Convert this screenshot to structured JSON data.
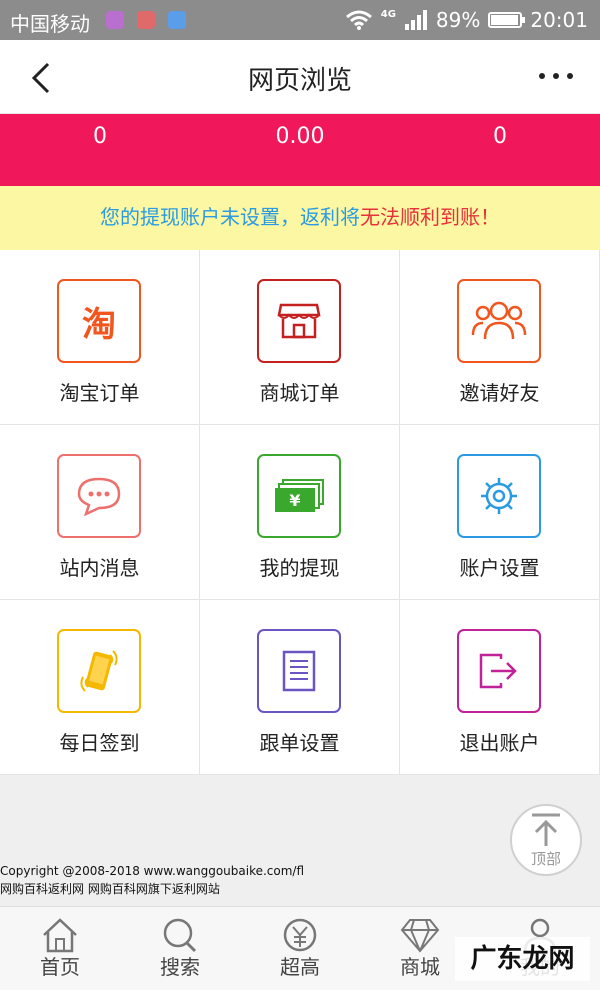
{
  "status_bar": {
    "carrier": "中国移动",
    "network": "4G",
    "battery": "89%",
    "time": "20:01",
    "battery_level": 0.89
  },
  "header": {
    "title": "网页浏览"
  },
  "stats": {
    "values": [
      "0",
      "0.00",
      "0"
    ]
  },
  "notice": {
    "part1": "您的提现账户未设置，返利将",
    "part2": "无法顺利到账！"
  },
  "menu": [
    {
      "label": "淘宝订单",
      "icon": "taobao-icon",
      "color": "#f0561d",
      "glyph": "淘"
    },
    {
      "label": "商城订单",
      "icon": "store-icon",
      "color": "#c4201f"
    },
    {
      "label": "邀请好友",
      "icon": "friends-icon",
      "color": "#f0561d"
    },
    {
      "label": "站内消息",
      "icon": "message-icon",
      "color": "#ef6f6c"
    },
    {
      "label": "我的提现",
      "icon": "money-icon",
      "color": "#3aa82c",
      "glyph": "¥"
    },
    {
      "label": "账户设置",
      "icon": "gear-icon",
      "color": "#2a9be3"
    },
    {
      "label": "每日签到",
      "icon": "phone-checkin-icon",
      "color": "#f5b800"
    },
    {
      "label": "跟单设置",
      "icon": "document-icon",
      "color": "#6a55c2"
    },
    {
      "label": "退出账户",
      "icon": "logout-icon",
      "color": "#c0229a"
    }
  ],
  "footer": {
    "copyright": "Copyright @2008-2018  www.wanggoubaike.com/fl",
    "line2": "网购百科返利网  网购百科网旗下返利网站"
  },
  "back_to_top": {
    "label": "顶部"
  },
  "tabbar": {
    "items": [
      {
        "label": "首页",
        "icon": "home-icon"
      },
      {
        "label": "搜索",
        "icon": "search-icon"
      },
      {
        "label": "超高",
        "icon": "yen-coin-icon"
      },
      {
        "label": "商城",
        "icon": "diamond-icon"
      },
      {
        "label": "我的",
        "icon": "user-icon"
      }
    ]
  },
  "watermark": "广东龙网"
}
